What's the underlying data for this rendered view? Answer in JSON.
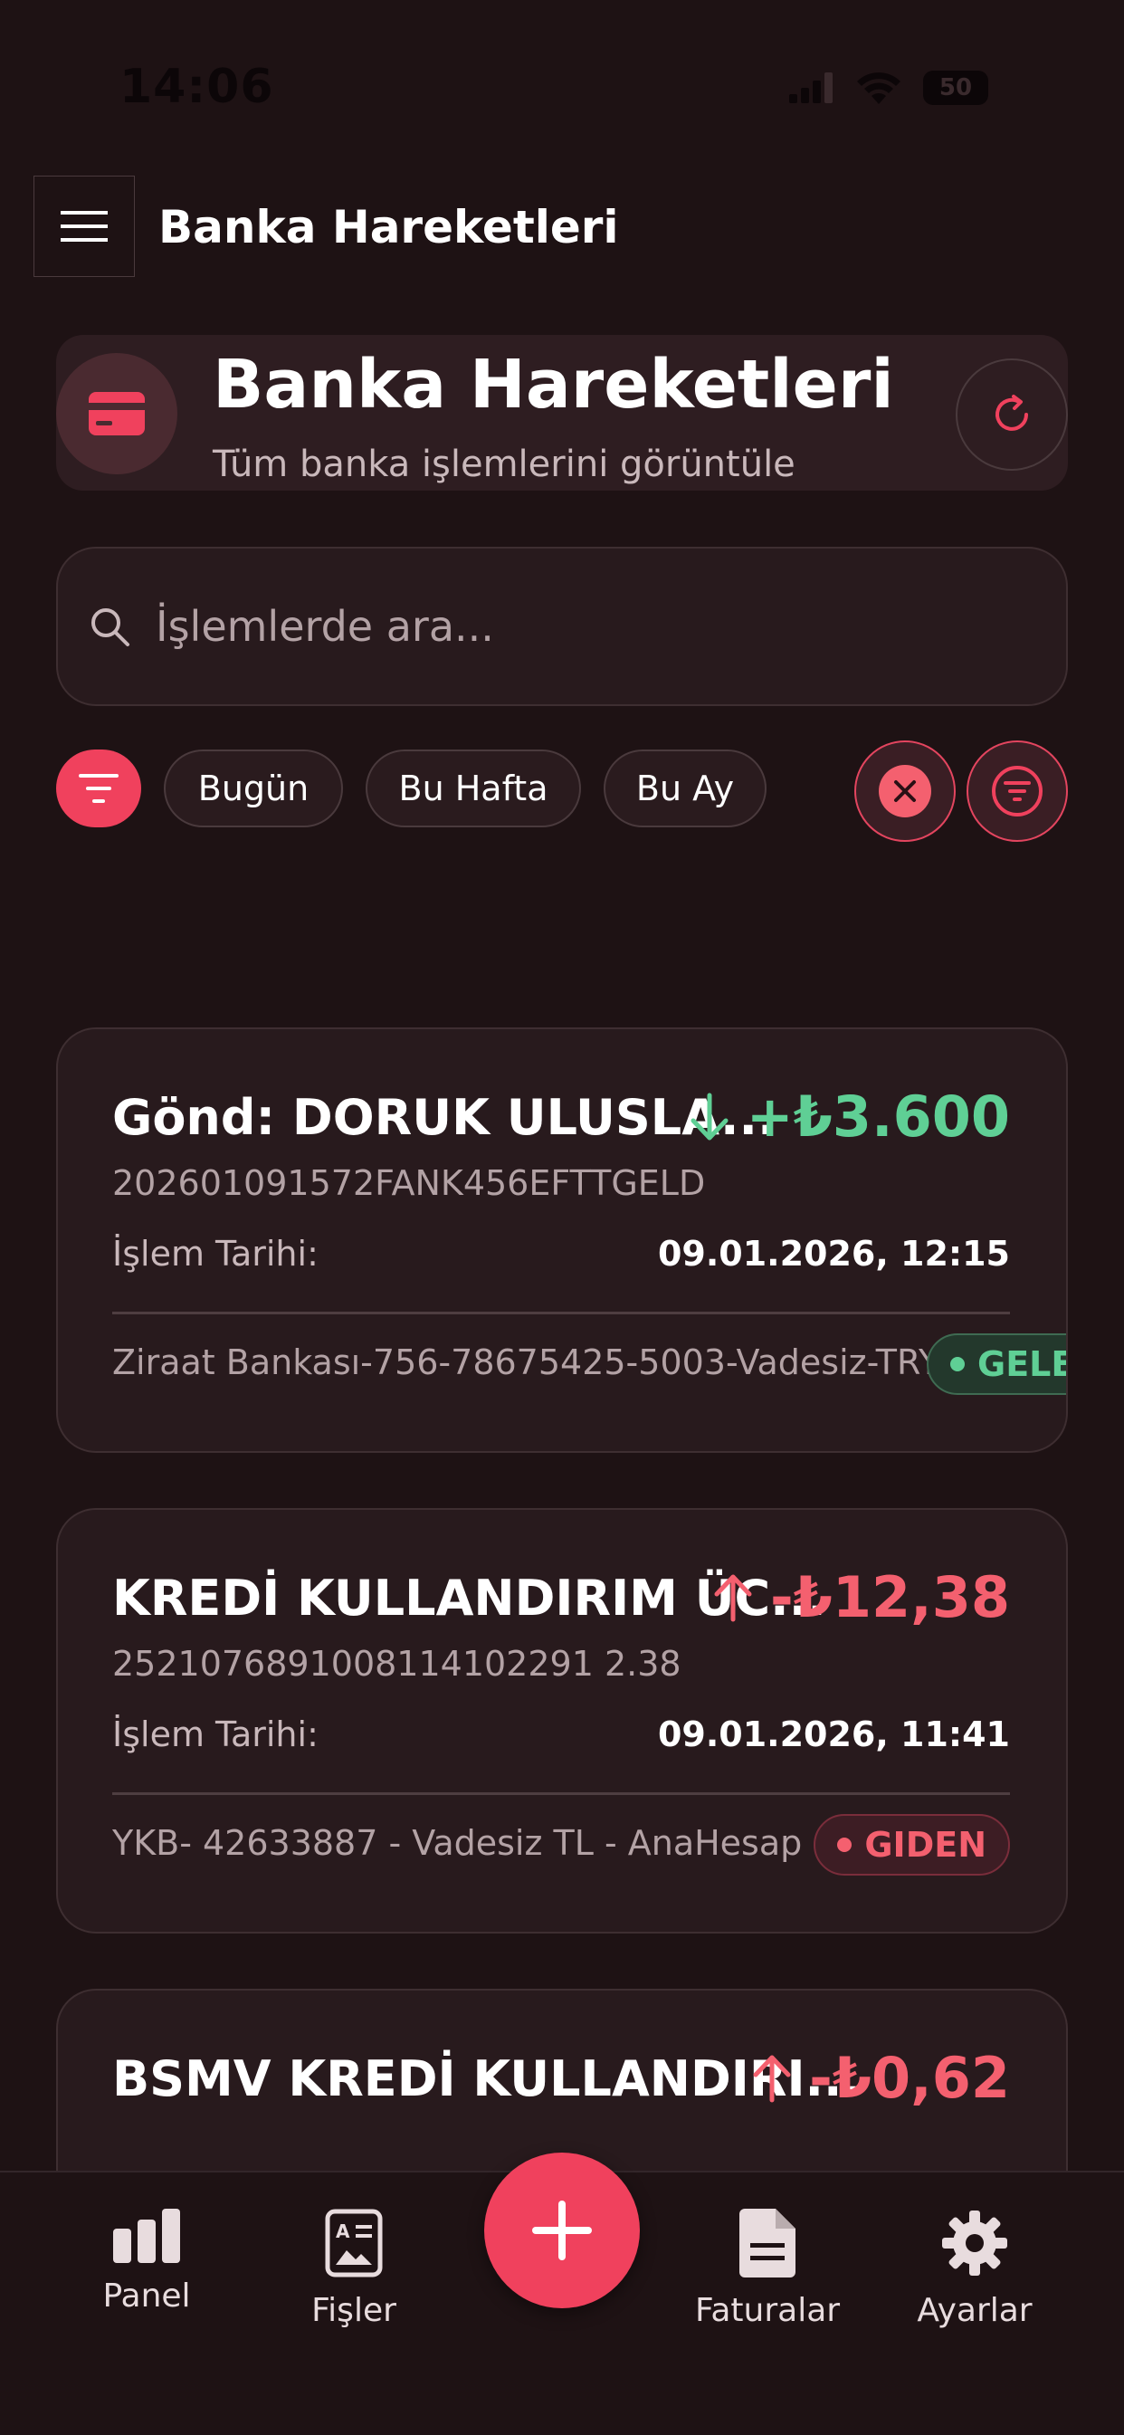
{
  "status_bar": {
    "time": "14:06",
    "battery": "50"
  },
  "topbar": {
    "title": "Banka Hareketleri"
  },
  "header": {
    "title": "Banka Hareketleri",
    "subtitle": "Tüm banka işlemlerini görüntüle"
  },
  "search": {
    "placeholder": "İşlemlerde ara..."
  },
  "filters": {
    "chips": [
      "Bugün",
      "Bu Hafta",
      "Bu Ay"
    ]
  },
  "transactions": [
    {
      "title": "Gönd: DORUK ULUSLA...",
      "amount": "+₺3.600",
      "reference": "202601091572FANK456EFTTGELD",
      "date_label": "İşlem Tarihi:",
      "date": "09.01.2026, 12:15",
      "account": "Ziraat Bankası-756-78675425-5003-Vadesiz-TRY",
      "badge": "GELEN",
      "direction": "in"
    },
    {
      "title": "KREDİ KULLANDIRIM ÜC...",
      "amount": "-₺12,38",
      "reference": "2521076891008114102291 2.38",
      "date_label": "İşlem Tarihi:",
      "date": "09.01.2026, 11:41",
      "account": "YKB- 42633887 - Vadesiz  TL - AnaHesap",
      "badge": "GIDEN",
      "direction": "out"
    },
    {
      "title": "BSMV KREDİ KULLANDIRI...",
      "amount": "-₺0,62",
      "direction": "out"
    }
  ],
  "bottom_nav": {
    "items": [
      {
        "label": "Panel",
        "icon": "bar-chart-icon"
      },
      {
        "label": "Fişler",
        "icon": "receipt-icon"
      },
      {
        "label": "Faturalar",
        "icon": "document-icon"
      },
      {
        "label": "Ayarlar",
        "icon": "gear-icon"
      }
    ],
    "fab_icon": "plus-icon"
  },
  "colors": {
    "background": "#1e1214",
    "accent": "#f0415d",
    "incoming": "#5fcf95",
    "outgoing": "#f4606f",
    "card": "#281a1d"
  }
}
